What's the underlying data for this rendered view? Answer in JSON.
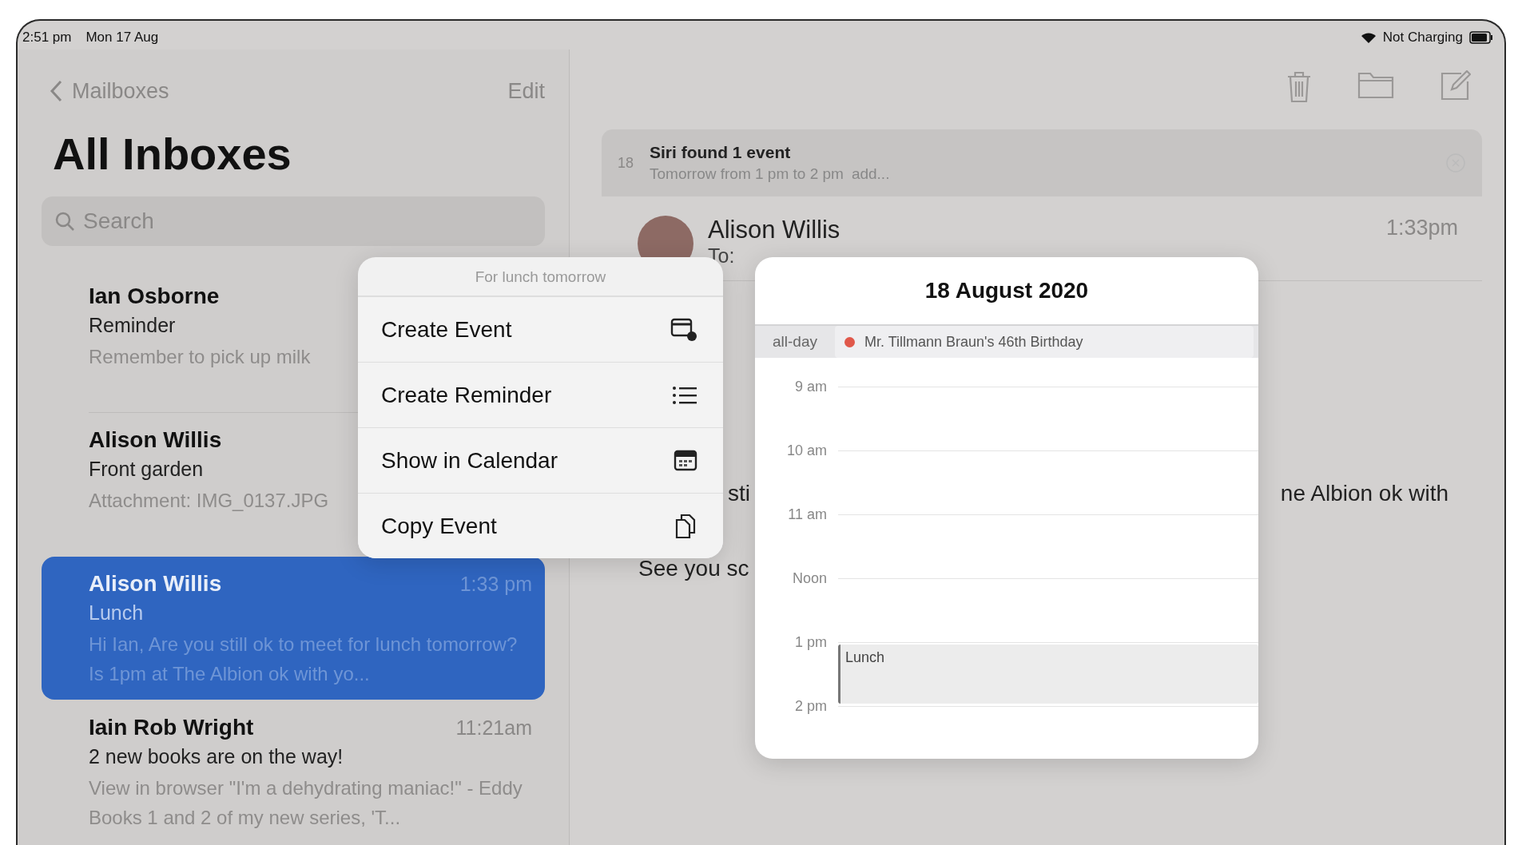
{
  "status_bar": {
    "time": "2:51 pm",
    "date": "Mon 17 Aug",
    "battery_label": "Not Charging"
  },
  "sidebar": {
    "back_label": "Mailboxes",
    "edit_label": "Edit",
    "title": "All Inboxes",
    "search": {
      "placeholder": "Search"
    },
    "messages": [
      {
        "sender": "Ian Osborne",
        "subject": "Reminder",
        "preview": "Remember to pick up milk",
        "selected": false
      },
      {
        "sender": "Alison Willis",
        "subject": "Front garden",
        "preview": "Attachment: IMG_0137.JPG",
        "selected": false
      },
      {
        "sender": "Alison Willis",
        "time": "1:33 pm",
        "subject": "Lunch",
        "preview": "Hi Ian, Are you still ok to meet for lunch tomorrow? Is 1pm at The Albion ok with yo...",
        "selected": true
      },
      {
        "sender": "Iain Rob Wright",
        "time": "11:21am",
        "subject": "2 new books are on the way!",
        "preview": "View in browser \"I'm a dehydrating maniac!\" - Eddy Books 1 and 2 of my new series, 'T...",
        "selected": false
      }
    ]
  },
  "message": {
    "banner": {
      "icon_day": "18",
      "title": "Siri found 1 event",
      "detail": "Tomorrow from 1 pm to 2 pm",
      "action": "add..."
    },
    "sender": "Alison Willis",
    "to_label": "To:",
    "time": "1:33pm",
    "body_lines": [
      {
        "left": "sti",
        "right": "ne Albion ok with"
      },
      {
        "left": "See you sc"
      }
    ]
  },
  "context_menu": {
    "title": "For lunch tomorrow",
    "items": [
      {
        "label": "Create Event",
        "kind": "calendar-add"
      },
      {
        "label": "Create Reminder",
        "kind": "list"
      },
      {
        "label": "Show in Calendar",
        "kind": "calendar"
      },
      {
        "label": "Copy Event",
        "kind": "copy"
      }
    ]
  },
  "calendar_preview": {
    "date": "18 August 2020",
    "all_day_label": "all-day",
    "all_day_event": {
      "title": "Mr. Tillmann Braun's 46th Birthday",
      "color": "#e0584a"
    },
    "hours": [
      {
        "label": "9 am"
      },
      {
        "label": "10 am"
      },
      {
        "label": "11 am"
      },
      {
        "label": "Noon"
      },
      {
        "label": "1 pm",
        "events": [
          {
            "title": "Lunch"
          }
        ]
      },
      {
        "label": "2 pm"
      }
    ]
  }
}
